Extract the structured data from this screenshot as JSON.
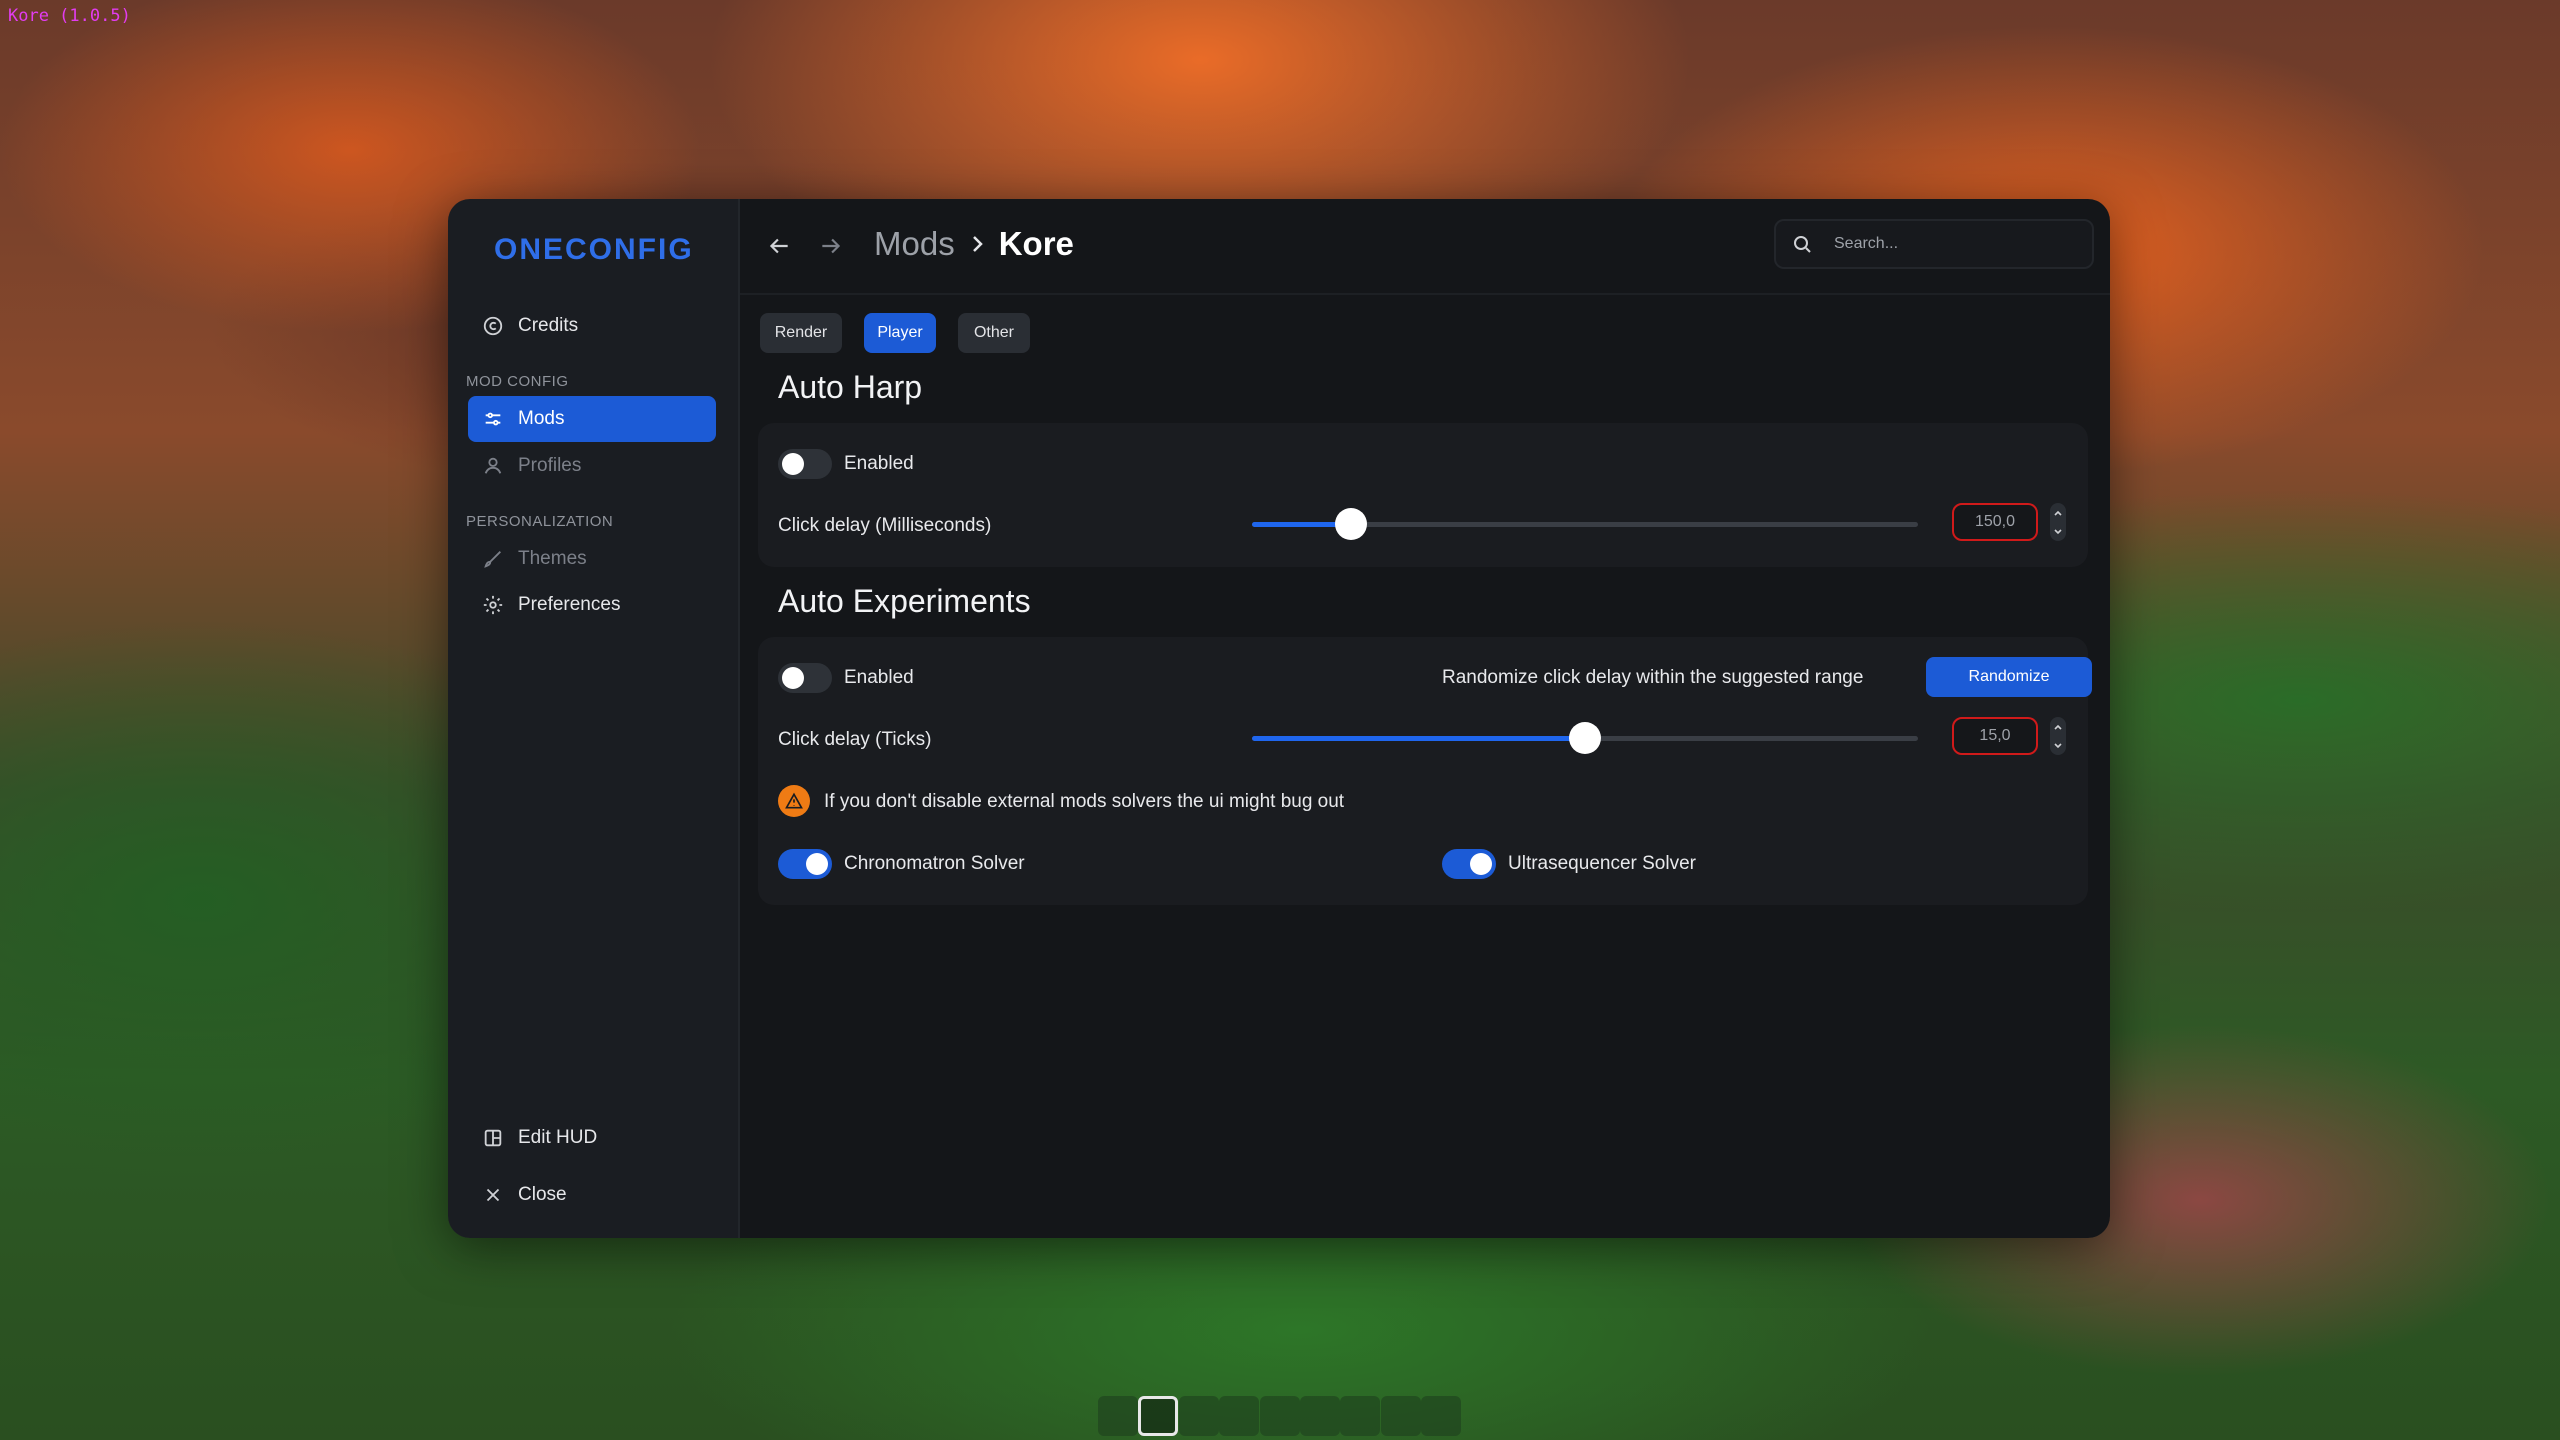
{
  "version_label": "Kore (1.0.5)",
  "brand": "ONECONFIG",
  "sidebar": {
    "credits": "Credits",
    "section_mod_config": "MOD CONFIG",
    "mods": "Mods",
    "profiles": "Profiles",
    "section_personalization": "PERSONALIZATION",
    "themes": "Themes",
    "preferences": "Preferences",
    "edit_hud": "Edit HUD",
    "close": "Close"
  },
  "breadcrumb": {
    "parent": "Mods",
    "current": "Kore"
  },
  "search": {
    "placeholder": "Search..."
  },
  "tabs": [
    {
      "label": "Render",
      "active": false
    },
    {
      "label": "Player",
      "active": true
    },
    {
      "label": "Other",
      "active": false
    }
  ],
  "auto_harp": {
    "title": "Auto Harp",
    "enabled_label": "Enabled",
    "enabled": false,
    "click_delay_label": "Click delay (Milliseconds)",
    "click_delay_value": "150,0",
    "slider_fraction": 0.148
  },
  "auto_experiments": {
    "title": "Auto Experiments",
    "enabled_label": "Enabled",
    "enabled": false,
    "randomize_label": "Randomize click delay within the suggested range",
    "randomize_button": "Randomize",
    "click_delay_label": "Click delay (Ticks)",
    "click_delay_value": "15,0",
    "slider_fraction": 0.5,
    "warning": "If you don't disable external mods solvers the ui might bug out",
    "chronomatron_label": "Chronomatron Solver",
    "chronomatron_enabled": true,
    "ultrasequencer_label": "Ultrasequencer Solver",
    "ultrasequencer_enabled": true
  },
  "colors": {
    "accent": "#1c5bd6",
    "error_border": "#d01a1a",
    "warning": "#ef7b14",
    "brand": "#2f6ee8"
  }
}
